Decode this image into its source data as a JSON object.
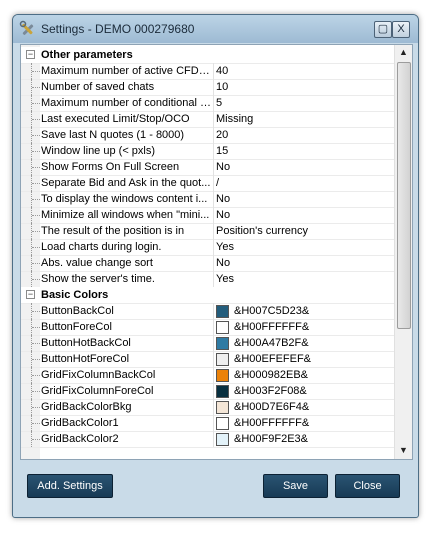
{
  "window": {
    "title": "Settings - DEMO 000279680"
  },
  "titlebar": {
    "max_glyph": "▢",
    "close_glyph": "X"
  },
  "scrollbar": {
    "up_glyph": "▲",
    "down_glyph": "▼"
  },
  "categories": {
    "other": {
      "toggle": "−",
      "label": "Other parameters"
    },
    "basic_colors": {
      "toggle": "−",
      "label": "Basic Colors"
    }
  },
  "other_params": [
    {
      "name": "Maximum number of active CFD in...",
      "value": "40"
    },
    {
      "name": "Number of saved chats",
      "value": "10"
    },
    {
      "name": "Maximum number of conditional o...",
      "value": "5"
    },
    {
      "name": "Last executed Limit/Stop/OCO",
      "value": "Missing"
    },
    {
      "name": "Save last N quotes (1 - 8000)",
      "value": "20"
    },
    {
      "name": "Window line up (< pxls)",
      "value": "15"
    },
    {
      "name": "Show Forms On Full Screen",
      "value": "No"
    },
    {
      "name": "Separate Bid and Ask in the quot...",
      "value": "/"
    },
    {
      "name": "To display the windows content i...",
      "value": "No"
    },
    {
      "name": "Minimize all windows when \"mini...",
      "value": "No"
    },
    {
      "name": "The result of the position is in",
      "value": "Position's currency"
    },
    {
      "name": "Load charts during login.",
      "value": "Yes"
    },
    {
      "name": "Abs. value change sort",
      "value": "No"
    },
    {
      "name": "Show the server's time.",
      "value": "Yes"
    }
  ],
  "basic_colors": [
    {
      "name": "ButtonBackCol",
      "value": "&H007C5D23&",
      "color": "#235D7C"
    },
    {
      "name": "ButtonForeCol",
      "value": "&H00FFFFFF&",
      "color": "#FFFFFF"
    },
    {
      "name": "ButtonHotBackCol",
      "value": "&H00A47B2F&",
      "color": "#2F7BA4"
    },
    {
      "name": "ButtonHotForeCol",
      "value": "&H00EFEFEF&",
      "color": "#EFEFEF"
    },
    {
      "name": "GridFixColumnBackCol",
      "value": "&H000982EB&",
      "color": "#EB8209"
    },
    {
      "name": "GridFixColumnForeCol",
      "value": "&H003F2F08&",
      "color": "#082F3F"
    },
    {
      "name": "GridBackColorBkg",
      "value": "&H00D7E6F4&",
      "color": "#F4E6D7"
    },
    {
      "name": "GridBackColor1",
      "value": "&H00FFFFFF&",
      "color": "#FFFFFF"
    },
    {
      "name": "GridBackColor2",
      "value": "&H00F9F2E3&",
      "color": "#E3F2F9"
    }
  ],
  "buttons": {
    "add_settings": "Add. Settings",
    "save": "Save",
    "close": "Close"
  },
  "colors": {
    "titlebar": "#9dbad3",
    "button": "#1f4763",
    "frame": "#c9dbe8"
  }
}
